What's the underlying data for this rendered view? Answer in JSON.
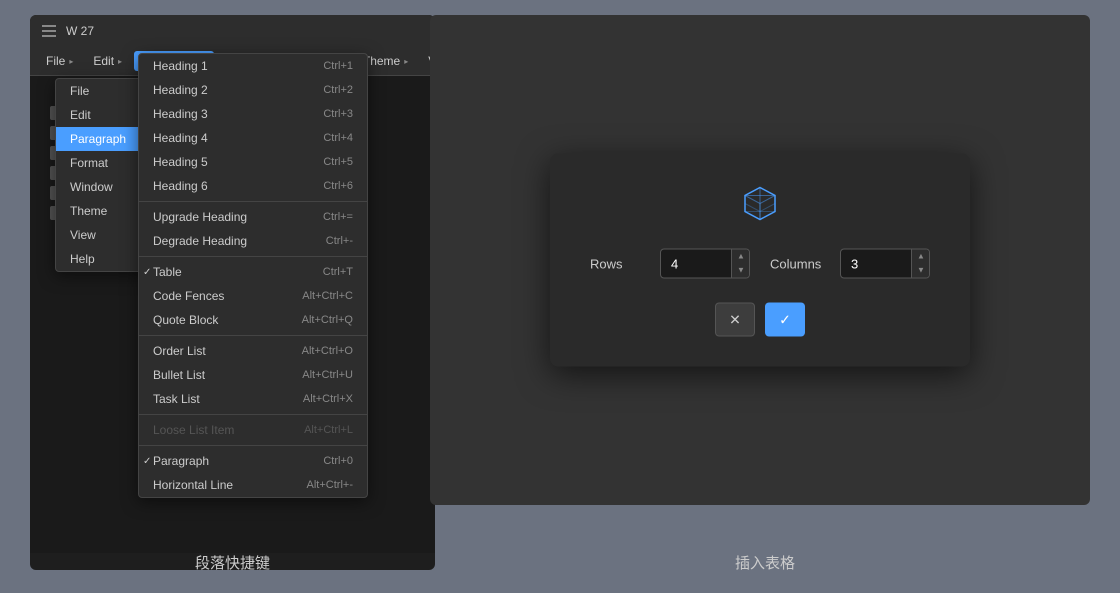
{
  "window": {
    "title": "W 27"
  },
  "menubar": {
    "items": [
      {
        "id": "file",
        "label": "File",
        "has_arrow": true
      },
      {
        "id": "edit",
        "label": "Edit",
        "has_arrow": true
      },
      {
        "id": "paragraph",
        "label": "Paragraph",
        "has_arrow": true,
        "active": true
      },
      {
        "id": "format",
        "label": "Format",
        "has_arrow": true
      },
      {
        "id": "window",
        "label": "Window",
        "has_arrow": true
      },
      {
        "id": "theme",
        "label": "Theme",
        "has_arrow": true
      },
      {
        "id": "view",
        "label": "View",
        "has_arrow": true
      },
      {
        "id": "help",
        "label": "Help",
        "has_arrow": true
      }
    ]
  },
  "submenu": {
    "items": [
      {
        "label": "Heading 1",
        "shortcut": "Ctrl+1"
      },
      {
        "label": "Heading 2",
        "shortcut": "Ctrl+2"
      },
      {
        "label": "Heading 3",
        "shortcut": "Ctrl+3"
      },
      {
        "label": "Heading 4",
        "shortcut": "Ctrl+4"
      },
      {
        "label": "Heading 5",
        "shortcut": "Ctrl+5"
      },
      {
        "label": "Heading 6",
        "shortcut": "Ctrl+6"
      }
    ],
    "divider1": true,
    "items2": [
      {
        "label": "Upgrade Heading",
        "shortcut": "Ctrl+="
      },
      {
        "label": "Degrade Heading",
        "shortcut": "Ctrl+-"
      }
    ],
    "divider2": true,
    "items3": [
      {
        "label": "Table",
        "shortcut": "Ctrl+T",
        "checked": true
      },
      {
        "label": "Code Fences",
        "shortcut": "Alt+Ctrl+C"
      },
      {
        "label": "Quote Block",
        "shortcut": "Alt+Ctrl+Q"
      }
    ],
    "divider3": true,
    "items4": [
      {
        "label": "Order List",
        "shortcut": "Alt+Ctrl+O"
      },
      {
        "label": "Bullet List",
        "shortcut": "Alt+Ctrl+U"
      },
      {
        "label": "Task List",
        "shortcut": "Alt+Ctrl+X"
      }
    ],
    "divider4": true,
    "items5": [
      {
        "label": "Loose List Item",
        "shortcut": "Alt+Ctrl+L",
        "disabled": true
      }
    ],
    "divider5": true,
    "items6": [
      {
        "label": "Paragraph",
        "shortcut": "Ctrl+0",
        "checked": true
      },
      {
        "label": "Horizontal Line",
        "shortcut": "Alt+Ctrl+-"
      }
    ]
  },
  "dialog": {
    "rows_label": "Rows",
    "rows_value": "4",
    "columns_label": "Columns",
    "columns_value": "3",
    "cancel_icon": "✕",
    "confirm_icon": "✓"
  },
  "captions": {
    "left": "段落快捷键",
    "right": "插入表格"
  }
}
